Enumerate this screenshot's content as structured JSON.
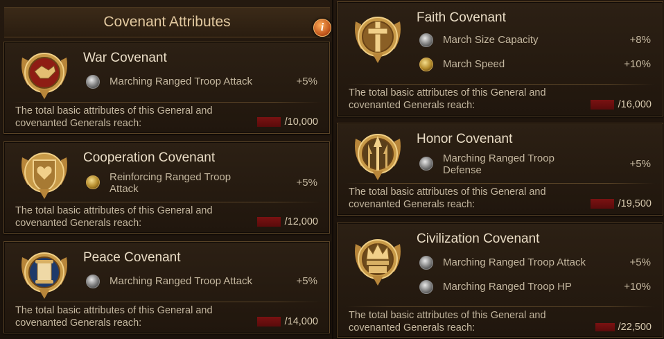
{
  "header": {
    "title": "Covenant Attributes",
    "info_glyph": "i"
  },
  "requirement_text": "The total basic attributes of this General and covenanted Generals reach:",
  "colors": {
    "requirement_bar": "#7a1212",
    "accent_gold": "#d8b064",
    "panel_border": "#5a4427"
  },
  "covenants": [
    {
      "name": "War Covenant",
      "emblem": "handshake-emblem-icon",
      "attributes": [
        {
          "name": "Marching Ranged Troop Attack",
          "value": "+5%",
          "icon": "troop-helmet-icon"
        }
      ],
      "requirement": "/10,000"
    },
    {
      "name": "Cooperation Covenant",
      "emblem": "heart-shield-emblem-icon",
      "attributes": [
        {
          "name": "Reinforcing Ranged Troop Attack",
          "value": "+5%",
          "icon": "troop-gold-icon"
        }
      ],
      "requirement": "/12,000"
    },
    {
      "name": "Peace Covenant",
      "emblem": "scroll-emblem-icon",
      "attributes": [
        {
          "name": "Marching Ranged Troop Attack",
          "value": "+5%",
          "icon": "troop-helmet-icon"
        }
      ],
      "requirement": "/14,000"
    },
    {
      "name": "Faith Covenant",
      "emblem": "cross-emblem-icon",
      "attributes": [
        {
          "name": "March Size Capacity",
          "value": "+8%",
          "icon": "troop-helmet-icon"
        },
        {
          "name": "March Speed",
          "value": "+10%",
          "icon": "troop-gold-icon"
        }
      ],
      "requirement": "/16,000"
    },
    {
      "name": "Honor Covenant",
      "emblem": "spear-emblem-icon",
      "attributes": [
        {
          "name": "Marching Ranged Troop Defense",
          "value": "+5%",
          "icon": "troop-helmet-icon"
        }
      ],
      "requirement": "/19,500"
    },
    {
      "name": "Civilization Covenant",
      "emblem": "crown-emblem-icon",
      "attributes": [
        {
          "name": "Marching Ranged Troop Attack",
          "value": "+5%",
          "icon": "troop-helmet-icon"
        },
        {
          "name": "Marching Ranged Troop HP",
          "value": "+10%",
          "icon": "troop-helmet-icon"
        }
      ],
      "requirement": "/22,500"
    }
  ]
}
